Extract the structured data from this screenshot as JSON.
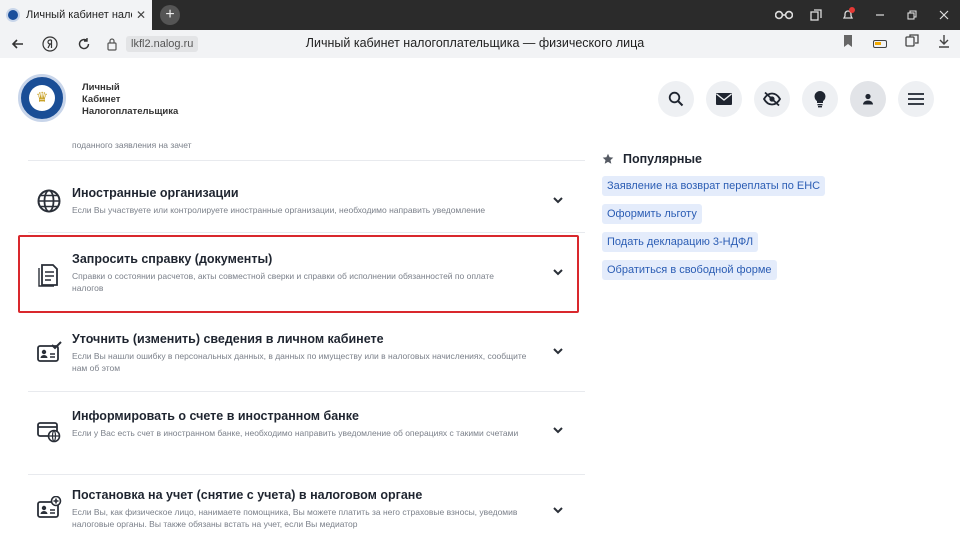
{
  "browser": {
    "tab_title": "Личный кабинет налогоплательщика",
    "tab_close": "✕",
    "new_tab": "+",
    "url": "lkfl2.nalog.ru",
    "page_title": "Личный кабинет налогоплательщика — физического лица"
  },
  "header": {
    "brand_line1": "Личный",
    "brand_line2": "Кабинет",
    "brand_line3": "Налогоплательщика",
    "buttons": [
      "search-icon",
      "mail-icon",
      "eye-off-icon",
      "lightbulb-icon",
      "user-icon",
      "menu-icon"
    ]
  },
  "services": {
    "partial_desc": "поданного заявления на зачет",
    "items": [
      {
        "title": "Иностранные организации",
        "desc": "Если Вы участвуете или контролируете иностранные организации, необходимо направить уведомление",
        "icon": "globe-icon"
      },
      {
        "title": "Запросить справку (документы)",
        "desc": "Справки о состоянии расчетов, акты совместной сверки и справки об исполнении обязанностей по оплате налогов",
        "icon": "document-icon"
      },
      {
        "title": "Уточнить (изменить) сведения в личном кабинете",
        "desc": "Если Вы нашли ошибку в персональных данных, в данных по имуществу или в налоговых начислениях, сообщите нам об этом",
        "icon": "id-card-check-icon"
      },
      {
        "title": "Информировать о счете в иностранном банке",
        "desc": "Если у Вас есть счет в иностранном банке, необходимо направить уведомление об операциях с такими счетами",
        "icon": "bank-account-icon"
      },
      {
        "title": "Постановка на учет (снятие с учета) в налоговом органе",
        "desc": "Если Вы, как физическое лицо, нанимаете помощника, Вы можете платить за него страховые взносы, уведомив налоговые органы. Вы также обязаны встать на учет, если Вы медиатор",
        "icon": "id-card-plus-icon"
      }
    ]
  },
  "popular": {
    "title": "Популярные",
    "links": [
      "Заявление на возврат переплаты по ЕНС",
      "Оформить льготу",
      "Подать декларацию 3-НДФЛ",
      "Обратиться в свободной форме"
    ]
  },
  "colors": {
    "highlight": "#d9282d",
    "link": "#2b5db4",
    "link_bg": "#e4ecfb",
    "brand_blue": "#1a4e96"
  }
}
